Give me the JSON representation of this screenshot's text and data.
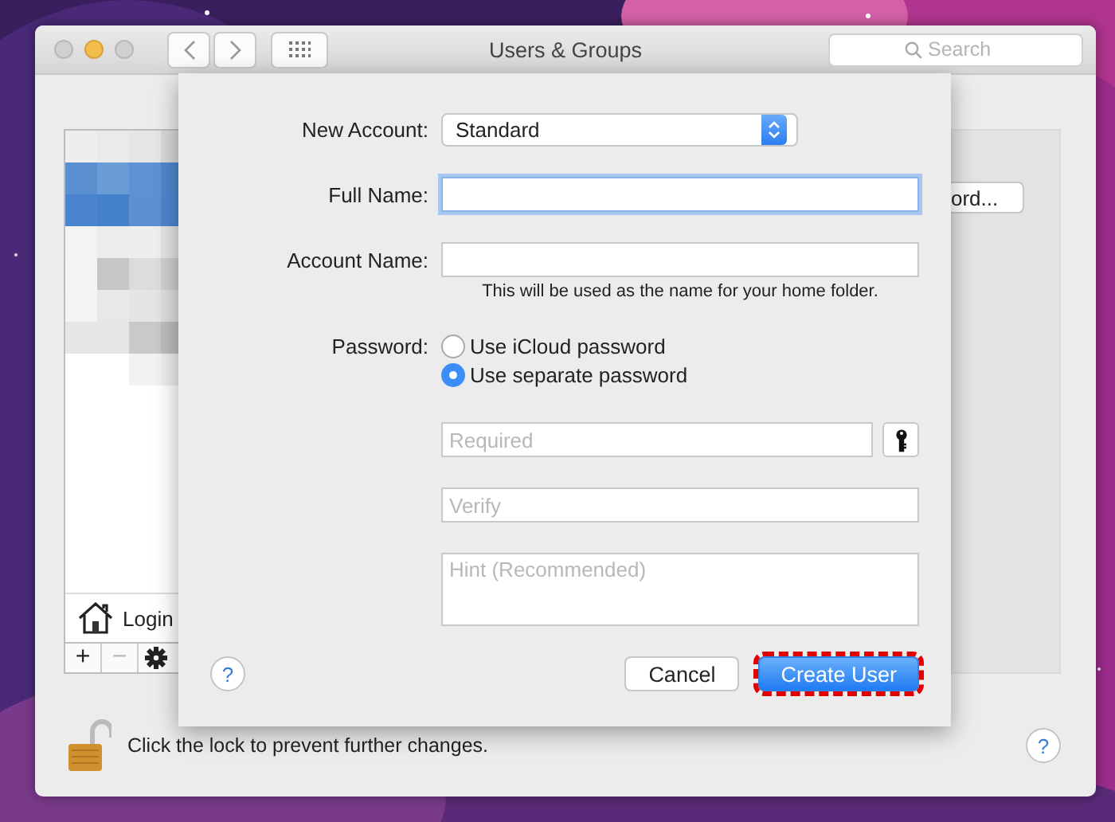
{
  "window": {
    "title": "Users & Groups",
    "lights": [
      {
        "kind": "close",
        "active": false
      },
      {
        "kind": "minimize",
        "active": true
      },
      {
        "kind": "zoom",
        "active": false
      }
    ]
  },
  "search": {
    "placeholder": "Search"
  },
  "sidebar": {
    "footer_item": "Login",
    "add": "+",
    "remove": "−"
  },
  "behind_button": "ord...",
  "lock": {
    "locked": false,
    "text": "Click the lock to prevent further changes."
  },
  "help": "?",
  "sheet": {
    "new_account": {
      "label": "New Account:",
      "value": "Standard"
    },
    "full_name": {
      "label": "Full Name:",
      "focused": true
    },
    "account_name": {
      "label": "Account Name:",
      "note": "This will be used as the name for your home folder."
    },
    "password": {
      "label": "Password:",
      "options": [
        {
          "label": "Use iCloud password",
          "selected": false
        },
        {
          "label": "Use separate password",
          "selected": true
        }
      ],
      "fields": [
        {
          "placeholder": "Required",
          "kind": "secure"
        },
        {
          "placeholder": "Verify",
          "kind": "plain"
        },
        {
          "placeholder": "Hint (Recommended)",
          "kind": "multiline"
        }
      ]
    },
    "help": "?",
    "buttons": [
      {
        "label": "Cancel",
        "default": false,
        "highlighted": false
      },
      {
        "label": "Create User",
        "default": true,
        "highlighted": true
      }
    ]
  }
}
